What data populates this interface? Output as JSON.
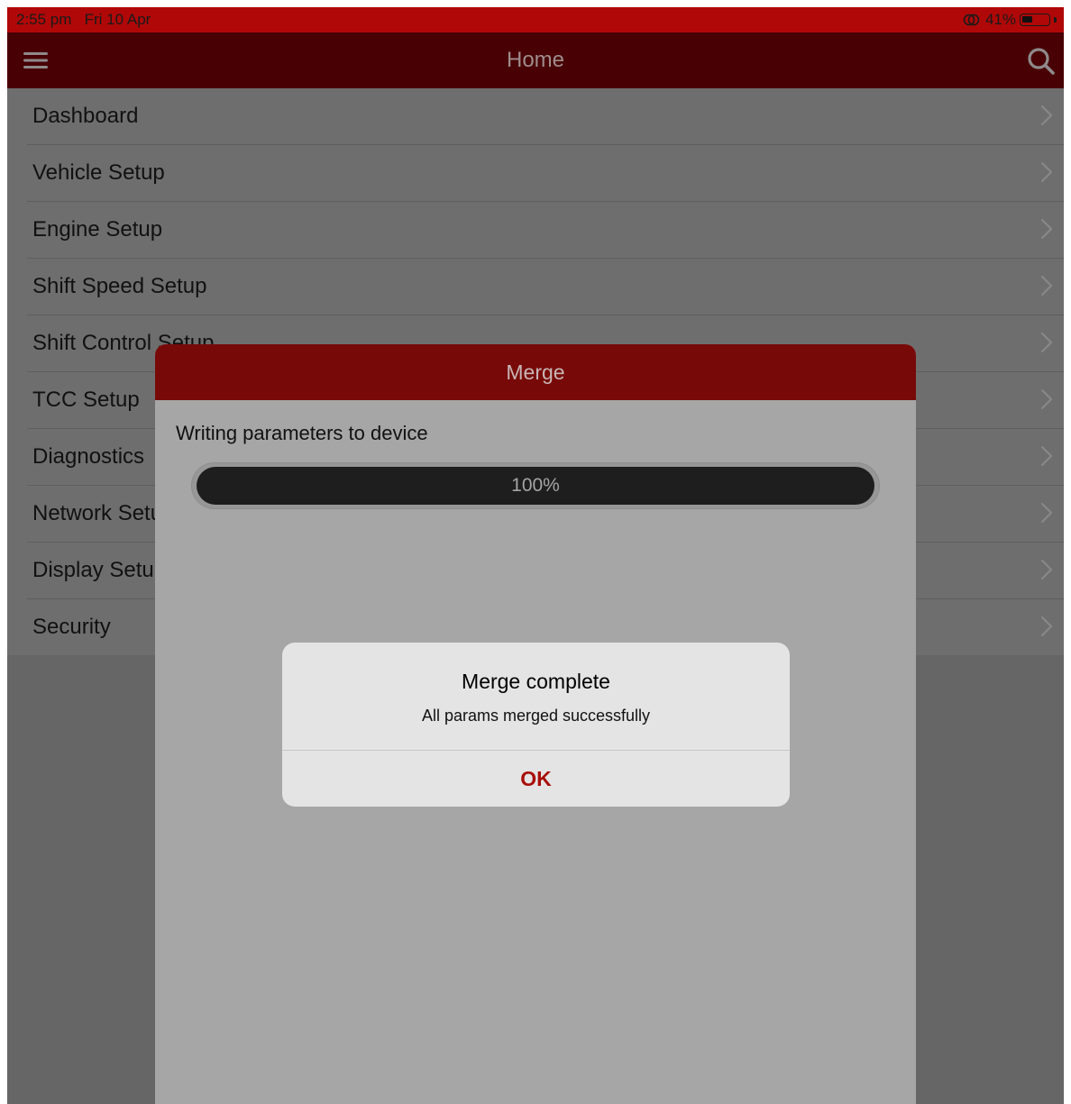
{
  "status_bar": {
    "time": "2:55 pm",
    "date": "Fri 10 Apr",
    "battery": "41%",
    "battery_level": 0.41,
    "icons": [
      "orientation-lock-icon",
      "battery-icon"
    ]
  },
  "nav_bar": {
    "title": "Home",
    "icons": [
      "hamburger-menu-icon",
      "search-icon"
    ]
  },
  "menu": {
    "items": [
      {
        "label": "Dashboard"
      },
      {
        "label": "Vehicle Setup"
      },
      {
        "label": "Engine Setup"
      },
      {
        "label": "Shift Speed Setup"
      },
      {
        "label": "Shift Control Setup"
      },
      {
        "label": "TCC Setup"
      },
      {
        "label": "Diagnostics"
      },
      {
        "label": "Network Setup"
      },
      {
        "label": "Display Setup"
      },
      {
        "label": "Security"
      }
    ]
  },
  "merge_dialog": {
    "title": "Merge",
    "message": "Writing parameters to device",
    "progress_text": "100%",
    "progress": 1.0
  },
  "alert": {
    "title": "Merge complete",
    "message": "All params merged successfully",
    "ok_label": "OK"
  },
  "colors": {
    "status_bar": "#b00808",
    "nav_bar": "#480005",
    "dialog_header": "#770a08",
    "accent": "#a80e0a"
  }
}
